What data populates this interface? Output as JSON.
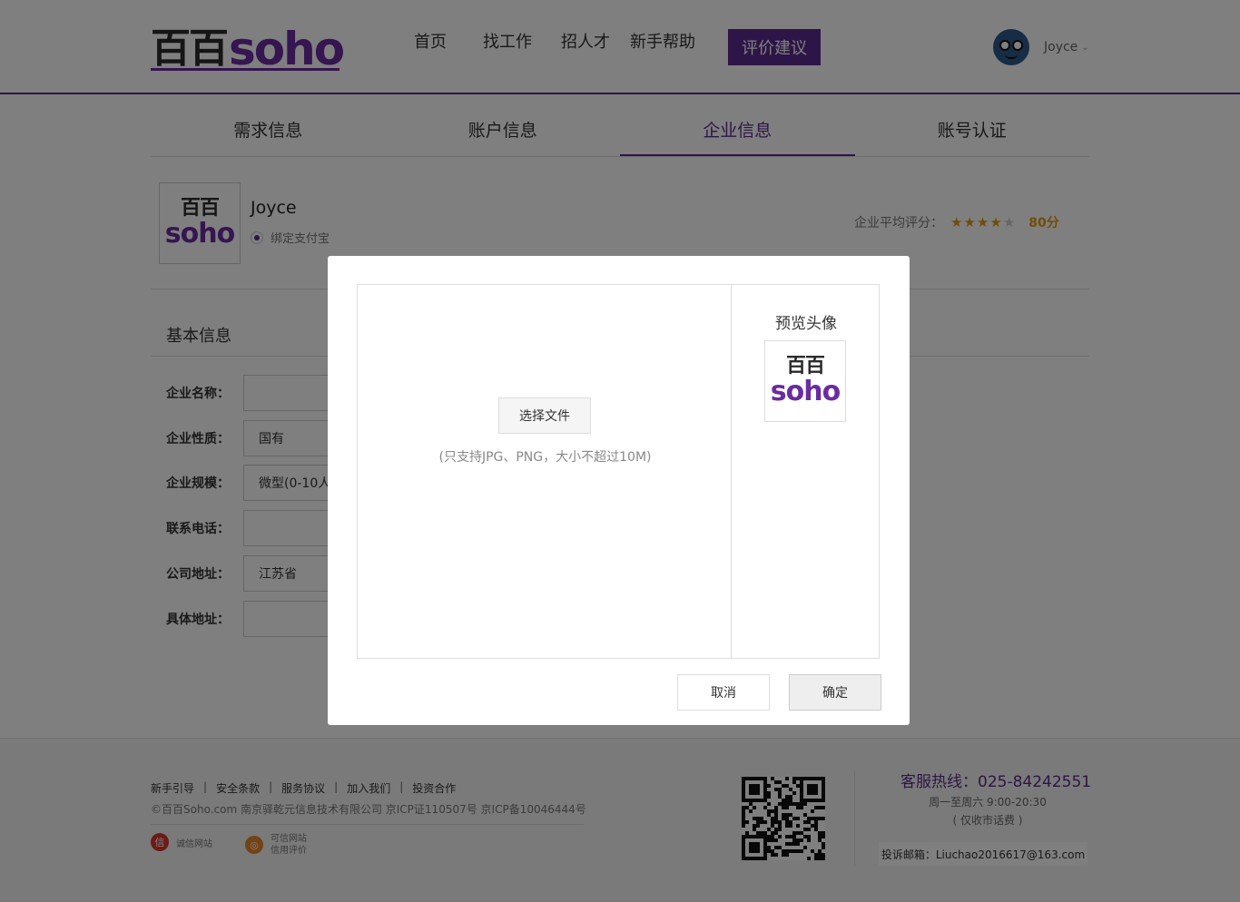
{
  "header": {
    "logo_cn": "百百",
    "logo_en": "soho",
    "nav": [
      "首页",
      "找工作",
      "招人才",
      "新手帮助"
    ],
    "nav_button": "评价建议",
    "user_name": "Joyce",
    "user_caret": "⌄"
  },
  "tabs": [
    {
      "label": "需求信息",
      "active": false
    },
    {
      "label": "账户信息",
      "active": false
    },
    {
      "label": "企业信息",
      "active": true
    },
    {
      "label": "账号认证",
      "active": false
    }
  ],
  "company": {
    "name": "Joyce",
    "alipay_label": "绑定支付宝",
    "rating_label": "企业平均评分：",
    "stars_filled": 4,
    "stars_total": 5,
    "score": "80分"
  },
  "form": {
    "section_title": "基本信息",
    "rows": [
      {
        "label": "企业名称：",
        "value": ""
      },
      {
        "label": "企业性质：",
        "value": "国有"
      },
      {
        "label": "企业规模：",
        "value": "微型(0-10人"
      },
      {
        "label": "联系电话：",
        "value": ""
      },
      {
        "label": "公司地址：",
        "value": "江苏省"
      },
      {
        "label": "具体地址：",
        "value": ""
      }
    ]
  },
  "footer": {
    "links": [
      "新手引导",
      "安全条款",
      "服务协议",
      "加入我们",
      "投资合作"
    ],
    "copyright": "©百百Soho.com  南京驿乾元信息技术有限公司  京ICP证110507号  京ICP备10046444号",
    "badge1": "诚信网站",
    "badge2_line1": "可信网站",
    "badge2_line2": "信用评价",
    "hotline": "客服热线：025-84242551",
    "hours": "周一至周六 9:00-20:30",
    "charge": "( 仅收市话费 )",
    "complaint": "投诉邮箱：Liuchao2016617@163.com"
  },
  "modal": {
    "choose_file": "选择文件",
    "hint": "(只支持JPG、PNG，大小不超过10M)",
    "preview_title": "预览头像",
    "cancel": "取消",
    "ok": "确定"
  },
  "colors": {
    "brand": "#5b2a8e",
    "star": "#e39a15",
    "overlay": "rgba(0,0,0,0.5)"
  }
}
